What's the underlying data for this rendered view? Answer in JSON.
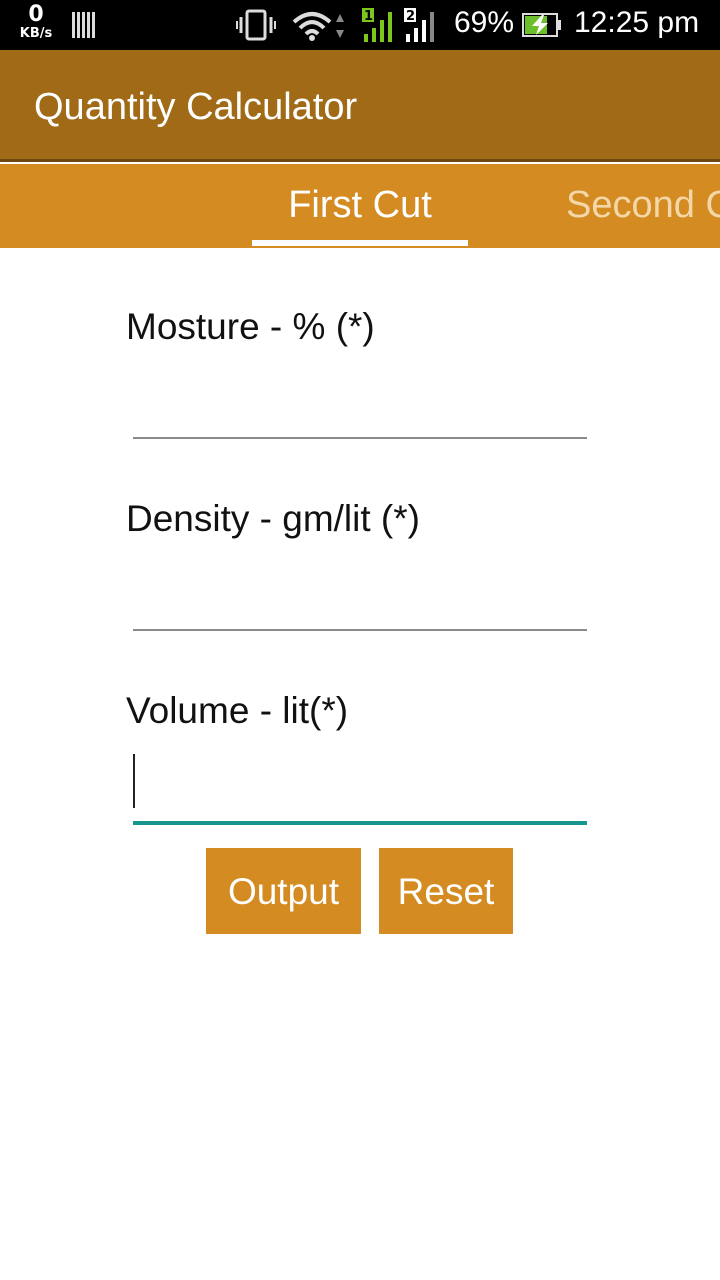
{
  "status_bar": {
    "speed_value": "0",
    "speed_unit": "KB/s",
    "battery_percent": "69%",
    "time": "12:25 pm",
    "sim1": "1",
    "sim2": "2",
    "icons": [
      "data-speed",
      "sim-card-bars",
      "vibrate-icon",
      "wifi-icon",
      "signal-icon",
      "signal-icon",
      "battery-charging-icon"
    ]
  },
  "app_bar": {
    "title": "Quantity Calculator"
  },
  "tabs": [
    {
      "label": "First Cut",
      "selected": true
    },
    {
      "label": "Second C",
      "selected": false
    }
  ],
  "form": {
    "fields": [
      {
        "label": "Mosture - % (*)",
        "value": ""
      },
      {
        "label": "Density - gm/lit (*)",
        "value": ""
      },
      {
        "label": "Volume - lit(*)",
        "value": "",
        "focused": true
      }
    ],
    "output_label": "Output",
    "reset_label": "Reset"
  },
  "colors": {
    "app_bar": "#a06a17",
    "tab_bar": "#d48b22",
    "button": "#d48b22",
    "focus_underline": "#14968c"
  }
}
